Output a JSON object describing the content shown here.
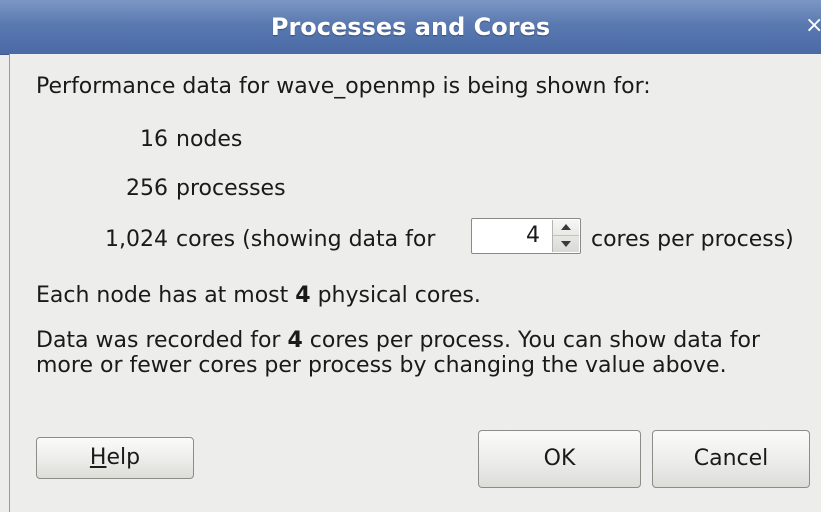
{
  "window": {
    "title": "Processes and Cores",
    "close_glyph": "×"
  },
  "content": {
    "intro": "Performance data for wave_openmp is being shown for:",
    "nodes": {
      "count": "16",
      "label": "nodes"
    },
    "processes": {
      "count": "256",
      "label": "processes"
    },
    "cores": {
      "count": "1,024",
      "label_before": "cores (showing data for",
      "label_after": "cores per process)"
    },
    "spinbox": {
      "value": "4"
    },
    "physical_cores": {
      "before": "Each node has at most",
      "value": "4",
      "after": "physical cores."
    },
    "recorded": {
      "before": "Data was recorded for",
      "value": "4",
      "after": "cores per process. You can show data for more or fewer cores per process by changing the value above."
    }
  },
  "buttons": {
    "help": {
      "mnemonic": "H",
      "rest": "elp"
    },
    "ok": "OK",
    "cancel": "Cancel"
  }
}
